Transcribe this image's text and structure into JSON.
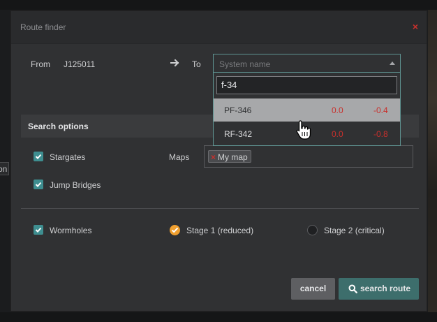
{
  "background": {
    "partial_label": "on"
  },
  "dialog": {
    "title": "Route finder",
    "close_symbol": "×",
    "from_label": "From",
    "from_value": "J125011",
    "to_label": "To",
    "to_placeholder": "System name"
  },
  "dropdown": {
    "search_value": "f-34",
    "items": [
      {
        "name": "PF-346",
        "value1": "0.0",
        "value2": "-0.4",
        "highlighted": true
      },
      {
        "name": "RF-342",
        "value1": "0.0",
        "value2": "-0.8",
        "highlighted": false
      }
    ]
  },
  "search_options": {
    "header": "Search options",
    "stargates_label": "Stargates",
    "jump_bridges_label": "Jump Bridges",
    "maps_label": "Maps",
    "map_tags": [
      "My map"
    ],
    "wormholes_label": "Wormholes",
    "stage1_label": "Stage 1 (reduced)",
    "stage2_label": "Stage 2 (critical)",
    "stargates_checked": true,
    "jump_bridges_checked": true,
    "wormholes_checked": true,
    "stage_selected": "Stage 1 (reduced)"
  },
  "footer": {
    "cancel_label": "cancel",
    "search_label": "search route"
  },
  "colors": {
    "accent_teal": "#3e8e90",
    "danger_red": "#c9302c",
    "radio_orange": "#f0a030",
    "modal_bg": "#303133"
  }
}
